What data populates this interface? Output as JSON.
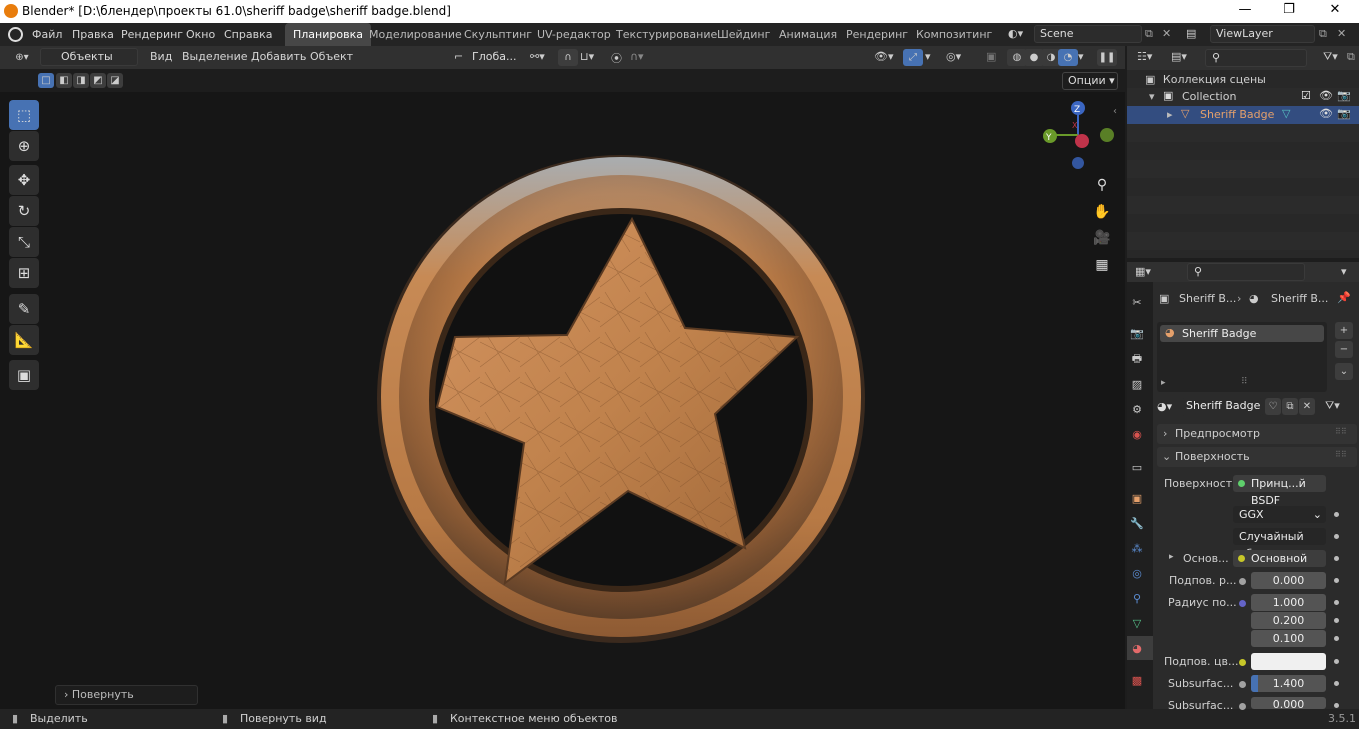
{
  "title_bar": {
    "title": "Blender* [D:\\блендер\\проекты 61.0\\sheriff badge\\sheriff badge.blend]",
    "minimize": "—",
    "maximize": "❐",
    "close": "✕"
  },
  "top_menu": [
    "Файл",
    "Правка",
    "Рендеринг",
    "Окно",
    "Справка"
  ],
  "workspaces": [
    {
      "label": "Планировка",
      "active": true
    },
    {
      "label": "Моделирование"
    },
    {
      "label": "Скульптинг"
    },
    {
      "label": "UV-редактор"
    },
    {
      "label": "Текстурирование"
    },
    {
      "label": "Шейдинг"
    },
    {
      "label": "Анимация"
    },
    {
      "label": "Рендеринг"
    },
    {
      "label": "Композитинг"
    }
  ],
  "scene_name": "Scene",
  "view_layer": "ViewLayer",
  "viewport_header": {
    "mode": "Объекты",
    "menus": [
      "Вид",
      "Выделение",
      "Добавить",
      "Объект"
    ],
    "transform_orientation": "Глоба...",
    "options_label": "Опции"
  },
  "viewport": {
    "last_operator": "Повернуть",
    "gizmo_labels": {
      "x": "X",
      "y": "Y",
      "z": "Z"
    }
  },
  "status_bar": {
    "items": [
      "Выделить",
      "Повернуть вид",
      "Контекстное меню объектов"
    ],
    "version": "3.5.1"
  },
  "outliner": {
    "scene_collection": "Коллекция сцены",
    "collection": "Collection",
    "object": "Sheriff Badge"
  },
  "properties": {
    "breadcrumb": [
      "Sheriff B...",
      "Sheriff B..."
    ],
    "material_slot": "Sheriff Badge",
    "material_name": "Sheriff Badge",
    "panels": {
      "preview": "Предпросмотр",
      "surface": "Поверхность"
    },
    "surface_label": "Поверхность",
    "surface_shader": "Принц...й BSDF",
    "distribution": "GGX",
    "subsurface_method": "Случайный об...",
    "base_color_label": "Основ...",
    "base_color_value": "Основной цвет",
    "subsurface_label": "Подпов. р...",
    "subsurface_value": "0.000",
    "radius_label": "Радиус по...",
    "radius_values": [
      "1.000",
      "0.200",
      "0.100"
    ],
    "subsurface_color_label": "Подпов. цв...",
    "subsurface_ior_label": "Subsurfac...",
    "subsurface_ior_value": "1.400",
    "subsurface_aniso_label": "Subsurfac...",
    "subsurface_aniso_value": "0.000"
  },
  "colors": {
    "accent": "#4772b3",
    "object_orange": "#e5a06b",
    "badge_copper": "#c98a52"
  }
}
